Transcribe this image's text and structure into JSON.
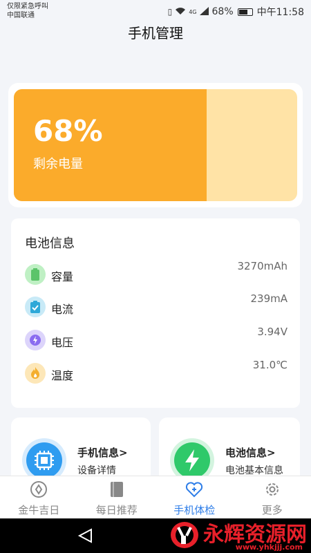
{
  "status_bar": {
    "carrier_line1": "仅限紧急呼叫",
    "carrier_line2": "中国联通",
    "signal_label": "4G",
    "battery_percent": "68%",
    "time": "中午11:58"
  },
  "header": {
    "title": "手机管理"
  },
  "battery_hero": {
    "percent_text": "68%",
    "label": "剩余电量",
    "level": 0.68,
    "fill_color": "#fbab2b",
    "track_color": "#ffe3a6"
  },
  "battery_info": {
    "title": "电池信息",
    "rows": [
      {
        "label": "容量",
        "value": "3270mAh",
        "icon": "battery-icon",
        "icon_bg": "#bff0c4",
        "icon_color": "#5bc46a"
      },
      {
        "label": "电流",
        "value": "239mA",
        "icon": "clipboard-check-icon",
        "icon_bg": "#c8eaf7",
        "icon_color": "#2ea8d8"
      },
      {
        "label": "电压",
        "value": "3.94V",
        "icon": "lightning-icon",
        "icon_bg": "#dcd4fb",
        "icon_color": "#8a6cf0"
      },
      {
        "label": "温度",
        "value": "31.0℃",
        "icon": "flame-icon",
        "icon_bg": "#fde7b8",
        "icon_color": "#f4ae2e"
      }
    ]
  },
  "tiles": [
    {
      "title": "手机信息>",
      "subtitle": "设备详情",
      "icon": "chip-icon",
      "color": "#2f9cf0"
    },
    {
      "title": "电池信息>",
      "subtitle": "电池基本信息",
      "icon": "lightning-icon",
      "color": "#2fc96a"
    }
  ],
  "tabbar": {
    "tabs": [
      {
        "label": "金牛吉日",
        "icon": "compass-icon"
      },
      {
        "label": "每日推荐",
        "icon": "book-icon"
      },
      {
        "label": "手机体检",
        "icon": "heart-plus-icon"
      },
      {
        "label": "更多",
        "icon": "gear-icon"
      }
    ],
    "active_index": 2,
    "active_color": "#2f7ee8"
  },
  "watermark": {
    "text": "永辉资源网",
    "url": "www.yhkjjj.com"
  }
}
